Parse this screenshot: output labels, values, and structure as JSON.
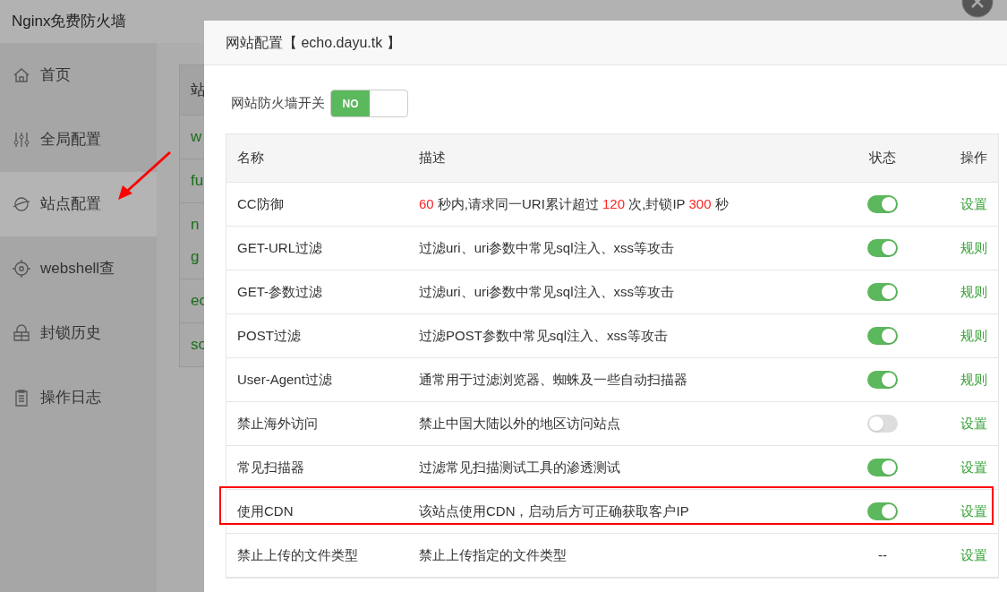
{
  "app_title": "Nginx免费防火墙",
  "sidebar": {
    "items": [
      {
        "label": "首页",
        "selected": false
      },
      {
        "label": "全局配置",
        "selected": false
      },
      {
        "label": "站点配置",
        "selected": true
      },
      {
        "label": "webshell查",
        "selected": false
      },
      {
        "label": "封锁历史",
        "selected": false
      },
      {
        "label": "操作日志",
        "selected": false
      }
    ]
  },
  "background_table": {
    "header": "站",
    "rows": [
      "w",
      "fu",
      "n\ng",
      "ec",
      "so"
    ]
  },
  "dialog": {
    "title": "网站配置【 echo.dayu.tk 】",
    "firewall_switch": {
      "label": "网站防火墙开关",
      "value": "NO",
      "on": true
    },
    "table": {
      "columns": [
        "名称",
        "描述",
        "状态",
        "操作"
      ],
      "rows": [
        {
          "name": "CC防御",
          "description": [
            {
              "text": "60",
              "emphasis": true
            },
            {
              "text": " 秒内,请求同一URI累计超过 ",
              "emphasis": false
            },
            {
              "text": "120",
              "emphasis": true
            },
            {
              "text": " 次,封锁IP ",
              "emphasis": false
            },
            {
              "text": "300",
              "emphasis": true
            },
            {
              "text": " 秒",
              "emphasis": false
            }
          ],
          "status": {
            "kind": "toggle",
            "on": true
          },
          "action": "设置",
          "highlighted": false
        },
        {
          "name": "GET-URL过滤",
          "description": [
            {
              "text": "过滤uri、uri参数中常见sql注入、xss等攻击",
              "emphasis": false
            }
          ],
          "status": {
            "kind": "toggle",
            "on": true
          },
          "action": "规则",
          "highlighted": false
        },
        {
          "name": "GET-参数过滤",
          "description": [
            {
              "text": "过滤uri、uri参数中常见sql注入、xss等攻击",
              "emphasis": false
            }
          ],
          "status": {
            "kind": "toggle",
            "on": true
          },
          "action": "规则",
          "highlighted": false
        },
        {
          "name": "POST过滤",
          "description": [
            {
              "text": "过滤POST参数中常见sql注入、xss等攻击",
              "emphasis": false
            }
          ],
          "status": {
            "kind": "toggle",
            "on": true
          },
          "action": "规则",
          "highlighted": false
        },
        {
          "name": "User-Agent过滤",
          "description": [
            {
              "text": "通常用于过滤浏览器、蜘蛛及一些自动扫描器",
              "emphasis": false
            }
          ],
          "status": {
            "kind": "toggle",
            "on": true
          },
          "action": "规则",
          "highlighted": false
        },
        {
          "name": "禁止海外访问",
          "description": [
            {
              "text": "禁止中国大陆以外的地区访问站点",
              "emphasis": false
            }
          ],
          "status": {
            "kind": "toggle",
            "on": false
          },
          "action": "设置",
          "highlighted": false
        },
        {
          "name": "常见扫描器",
          "description": [
            {
              "text": "过滤常见扫描测试工具的渗透测试",
              "emphasis": false
            }
          ],
          "status": {
            "kind": "toggle",
            "on": true
          },
          "action": "设置",
          "highlighted": false
        },
        {
          "name": "使用CDN",
          "description": [
            {
              "text": "该站点使用CDN，启动后方可正确获取客户IP",
              "emphasis": false
            }
          ],
          "status": {
            "kind": "toggle",
            "on": true
          },
          "action": "设置",
          "highlighted": true
        },
        {
          "name": "禁止上传的文件类型",
          "description": [
            {
              "text": "禁止上传指定的文件类型",
              "emphasis": false
            }
          ],
          "status": {
            "kind": "text",
            "text": "--"
          },
          "action": "设置",
          "highlighted": false
        }
      ]
    }
  },
  "annotation_arrow": true
}
